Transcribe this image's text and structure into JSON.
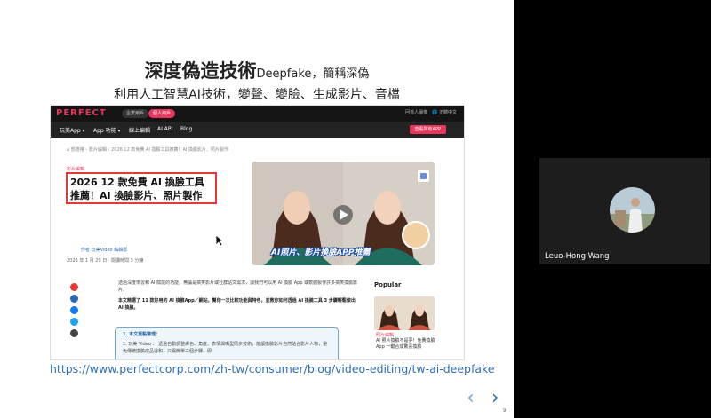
{
  "slide": {
    "title_main": "深度偽造技術",
    "title_term": "Deepfake",
    "title_suffix": "，簡稱深偽",
    "subtitle": "利用人工智慧AI技術，變聲、變臉、生成影片、音檔",
    "url": "https://www.perfectcorp.com/zh-tw/consumer/blog/video-editing/tw-ai-deepfake",
    "page_number": "9",
    "nav_prev": "‹",
    "nav_next": "›"
  },
  "website": {
    "logo": "PERFECT",
    "pill_business": "企業用戶",
    "pill_personal": "個人用戶",
    "top_right": "回首人圖像　🌐 正體中文",
    "nav": [
      "玩美App ▾",
      "App 功能 ▾",
      "線上編輯",
      "AI API",
      "Blog"
    ],
    "cta": "查看所有APP",
    "breadcrumb": "⌂  部落格  ›  影片編輯  ›  2026 12 款免費 AI 換臉工具推薦！AI 換臉影片、照片製作",
    "category": "影片編輯",
    "headline": "2026 12 款免費 AI 換臉工具推薦！AI 換臉影片、照片製作",
    "author": "作者  玩美Video 編輯群",
    "date": "2026 年 1 月 29 日 · 閱讀時間 3 分鐘",
    "hero_caption": "AI照片、影片換臉APP推薦",
    "intro_1": "透過深度學習和 AI 賦能的功能，無論是搞笑影片或社群貼文需求，讓我們可以用 AI 換臉 App 或軟體製作許多搞笑換臉影片。",
    "intro_2": "本文精選了 11 款好用的 AI 換臉App／網站，幫你一次比較功能與特色，並教你如何透過 AI 換臉工具 3 步驟輕鬆做出 AI 換臉。",
    "summary_title": "1. 本文重點整理：",
    "summary_item": "1. 玩美 Video ： 透過自動調整膚色、角度、表情與嘴型同步技術，能讓換臉影片自然貼合影片人物，避免傳統換臉成品違和，只需簡單三個步驟，即",
    "popular_label": "Popular",
    "popular_category": "照片編輯",
    "popular_text": "AI 照片換臉不是夢！免費換臉 App 一鍵合成驚喜換臉"
  },
  "participant": {
    "name": "Leuo-Hong Wang"
  },
  "colors": {
    "brand": "#e8365d",
    "highlight_box": "#e53935",
    "link": "#2f6fb5"
  }
}
